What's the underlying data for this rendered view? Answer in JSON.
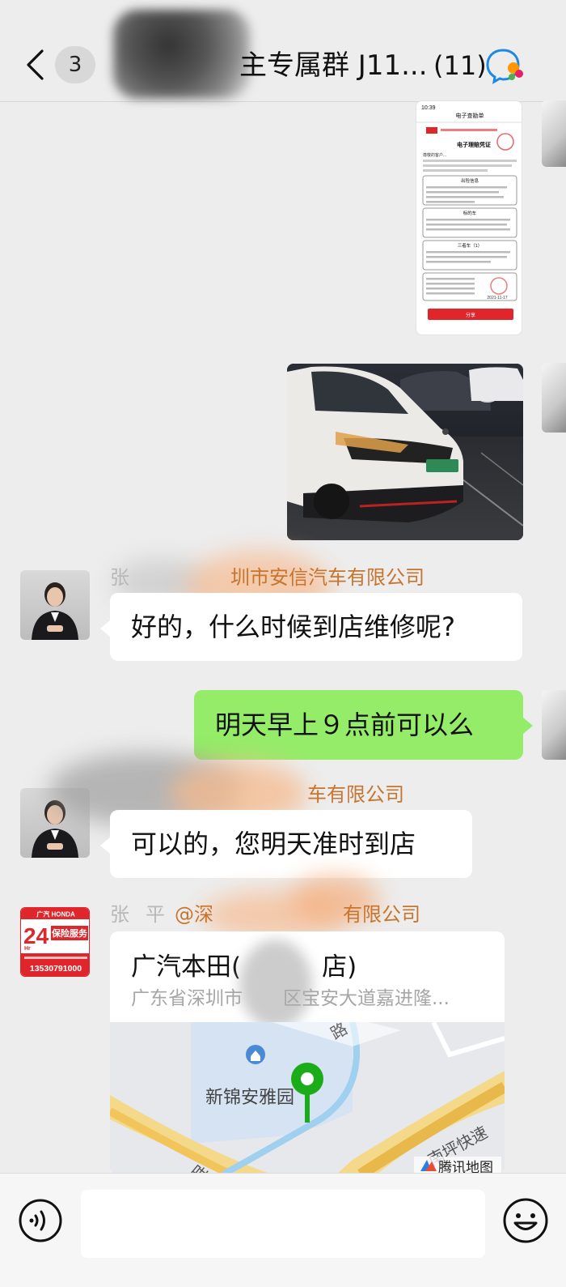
{
  "header": {
    "unread_count": "3",
    "title": "主专属群 J11...",
    "member_count": "(11)"
  },
  "messages": {
    "doc_screenshot": {
      "status_time": "10:39",
      "page_title": "电子查勘单",
      "heading": "电子理赔凭证",
      "intro": "尊敬的客户...",
      "section_accident": "出险信息",
      "section_own_car": "标的车",
      "section_third_car": "三者车（1）",
      "date": "2021-11-17",
      "share_button": "分享"
    },
    "msg1": {
      "sender_prefix": "张",
      "sender_company": "圳市安信汽车有限公司",
      "text": "好的，什么时候到店维修呢?"
    },
    "msg2": {
      "text": "明天早上９点前可以么"
    },
    "msg3": {
      "sender_company": "车有限公司",
      "text": "可以的，您明天准时到店"
    },
    "msg4": {
      "sender_prefix": "张",
      "sender_mid": "平",
      "sender_at": "@深",
      "sender_company": "有限公司",
      "avatar": {
        "brand": "广汽 HONDA",
        "big": "24",
        "hr": "Hr",
        "service": "保险服务",
        "phone": "13530791000"
      },
      "location": {
        "name": "广汽本田(",
        "name_end": "店)",
        "address": "广东省深圳市",
        "address_end": "区宝安大道嘉进隆...",
        "map_place": "新锦安雅园",
        "map_road1": "南坪快速",
        "map_road2": "路",
        "map_label_bottom": "咁",
        "map_provider": "腾讯地图"
      }
    }
  },
  "input": {
    "value": "",
    "placeholder": ""
  },
  "colors": {
    "bg": "#ededed",
    "green_bubble": "#95ec69",
    "sender_orange": "#c7752e",
    "map_pin": "#1aad19",
    "red_brand": "#e0262b"
  }
}
